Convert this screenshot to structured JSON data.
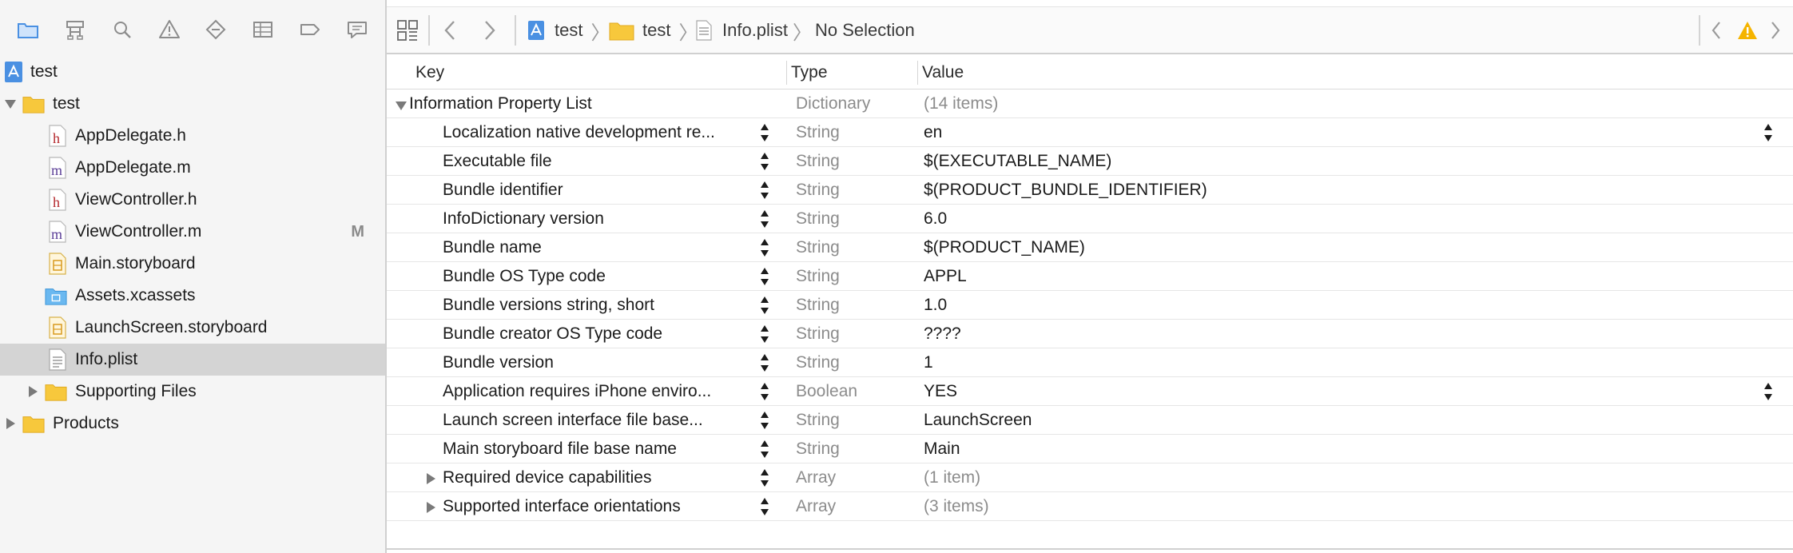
{
  "navigator": {
    "toolbar_icons": [
      "folder-icon",
      "hierarchy-icon",
      "search-icon",
      "warning-icon",
      "diamond-icon",
      "list-icon",
      "tag-icon",
      "chat-icon"
    ],
    "tree": [
      {
        "label": "test",
        "icon": "project-icon",
        "level": 0,
        "disclosure": "none"
      },
      {
        "label": "test",
        "icon": "folder-icon",
        "level": 0,
        "disclosure": "open"
      },
      {
        "label": "AppDelegate.h",
        "icon": "h-file-icon",
        "level": 1,
        "disclosure": "none"
      },
      {
        "label": "AppDelegate.m",
        "icon": "m-file-icon",
        "level": 1,
        "disclosure": "none"
      },
      {
        "label": "ViewController.h",
        "icon": "h-file-icon",
        "level": 1,
        "disclosure": "none"
      },
      {
        "label": "ViewController.m",
        "icon": "m-file-icon",
        "level": 1,
        "disclosure": "none",
        "badge": "M"
      },
      {
        "label": "Main.storyboard",
        "icon": "storyboard-icon",
        "level": 1,
        "disclosure": "none"
      },
      {
        "label": "Assets.xcassets",
        "icon": "assets-folder-icon",
        "level": 1,
        "disclosure": "none"
      },
      {
        "label": "LaunchScreen.storyboard",
        "icon": "storyboard-icon",
        "level": 1,
        "disclosure": "none"
      },
      {
        "label": "Info.plist",
        "icon": "plist-icon",
        "level": 1,
        "disclosure": "none",
        "selected": true
      },
      {
        "label": "Supporting Files",
        "icon": "folder-icon",
        "level": 1,
        "disclosure": "closed"
      },
      {
        "label": "Products",
        "icon": "folder-icon",
        "level": 0,
        "disclosure": "closed"
      }
    ]
  },
  "jump_bar": {
    "crumbs": [
      "test",
      "test",
      "Info.plist",
      "No Selection"
    ]
  },
  "plist": {
    "headers": {
      "key": "Key",
      "type": "Type",
      "value": "Value"
    },
    "root": {
      "key": "Information Property List",
      "type": "Dictionary",
      "value": "(14 items)"
    },
    "rows": [
      {
        "key": "Localization native development re...",
        "type": "String",
        "value": "en",
        "value_stepper": true
      },
      {
        "key": "Executable file",
        "type": "String",
        "value": "$(EXECUTABLE_NAME)"
      },
      {
        "key": "Bundle identifier",
        "type": "String",
        "value": "$(PRODUCT_BUNDLE_IDENTIFIER)"
      },
      {
        "key": "InfoDictionary version",
        "type": "String",
        "value": "6.0"
      },
      {
        "key": "Bundle name",
        "type": "String",
        "value": "$(PRODUCT_NAME)"
      },
      {
        "key": "Bundle OS Type code",
        "type": "String",
        "value": "APPL"
      },
      {
        "key": "Bundle versions string, short",
        "type": "String",
        "value": "1.0"
      },
      {
        "key": "Bundle creator OS Type code",
        "type": "String",
        "value": "????"
      },
      {
        "key": "Bundle version",
        "type": "String",
        "value": "1"
      },
      {
        "key": "Application requires iPhone enviro...",
        "type": "Boolean",
        "value": "YES",
        "value_stepper": true
      },
      {
        "key": "Launch screen interface file base...",
        "type": "String",
        "value": "LaunchScreen"
      },
      {
        "key": "Main storyboard file base name",
        "type": "String",
        "value": "Main"
      },
      {
        "key": "Required device capabilities",
        "type": "Array",
        "value": "(1 item)",
        "collapsible": true
      },
      {
        "key": "Supported interface orientations",
        "type": "Array",
        "value": "(3 items)",
        "collapsible": true
      }
    ]
  },
  "colors": {
    "accent_blue": "#4a90e2",
    "folder_yellow": "#f7c83c",
    "warning_yellow": "#f5b400",
    "h_file_red": "#b3262b",
    "m_file_purple": "#5a3d96"
  }
}
